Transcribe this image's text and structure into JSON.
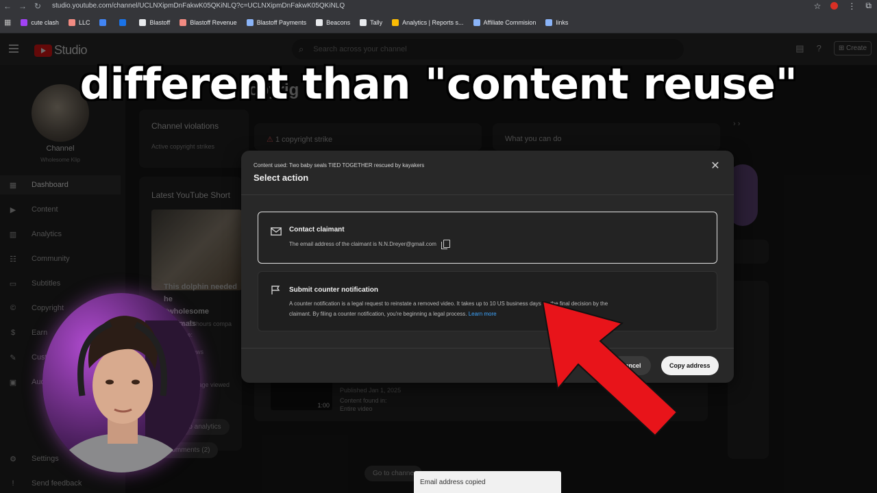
{
  "browser": {
    "url": "studio.youtube.com/channel/UCLNXipmDnFakwK05QKiNLQ?c=UCLNXipmDnFakwK05QKiNLQ",
    "bookmarks": [
      {
        "label": "cute clash",
        "color": "#a142f4"
      },
      {
        "label": "LLC",
        "color": "#f28b82"
      },
      {
        "label": "",
        "color": "#4285f4"
      },
      {
        "label": "",
        "color": "#1a73e8"
      },
      {
        "label": "Blastoff",
        "color": "#e8eaed"
      },
      {
        "label": "Blastoff Revenue",
        "color": "#f28b82"
      },
      {
        "label": "Blastoff Payments",
        "color": "#8ab4f8"
      },
      {
        "label": "Beacons",
        "color": "#e8eaed"
      },
      {
        "label": "Tally",
        "color": "#e8eaed"
      },
      {
        "label": "Analytics | Reports s...",
        "color": "#fbbc04"
      },
      {
        "label": "Affiliate Commision",
        "color": "#8ab4f8"
      },
      {
        "label": "links",
        "color": "#8ab4f8"
      }
    ]
  },
  "studio": {
    "logo_text": "Studio",
    "search_placeholder": "Search across your channel",
    "create_label": "Create"
  },
  "sidebar": {
    "channel_name": "Channel",
    "channel_handle": "Wholesome Klip",
    "items": [
      {
        "label": "Dashboard",
        "icon": "dashboard-icon"
      },
      {
        "label": "Content",
        "icon": "content-icon"
      },
      {
        "label": "Analytics",
        "icon": "analytics-icon"
      },
      {
        "label": "Community",
        "icon": "community-icon"
      },
      {
        "label": "Subtitles",
        "icon": "subtitles-icon"
      },
      {
        "label": "Copyright",
        "icon": "copyright-icon"
      },
      {
        "label": "Earn",
        "icon": "earn-icon"
      },
      {
        "label": "Custo",
        "icon": "customization-icon"
      },
      {
        "label": "Audi",
        "icon": "audio-library-icon"
      }
    ],
    "settings": "Settings",
    "feedback": "Send feedback"
  },
  "dashboard": {
    "channel_violations": "Channel violations",
    "active_strikes": "Active copyright strikes",
    "strike_count": "1 copyright strike",
    "what_you_can_do": "What you can do",
    "latest_shorts": "Latest YouTube Short",
    "short_caption_1": "This dolphin needed he",
    "short_caption_2": "#wholesome #animals",
    "stats_1": "lays 23 hours compa",
    "stats_2": "ice:",
    "stats_3": "ews",
    "stats_4": "entage viewed",
    "btn_video_analytics": "ideo analytics",
    "btn_comments": "e comments (2)",
    "published": "Published Jan 1, 2025",
    "content_found_in": "Content found in:",
    "entire_video": "Entire video",
    "duration": "1:00",
    "go_to_channel": "Go to channe",
    "partial_copyright": "opyrig"
  },
  "dialog": {
    "content_used": "Content used: Two baby seals TIED TOGETHER rescued by kayakers",
    "title": "Select action",
    "option_contact": {
      "title": "Contact claimant",
      "desc": "The email address of the claimant is N.N.Dreyer@gmail.com"
    },
    "option_counter": {
      "title": "Submit counter notification",
      "desc_line1": "A counter notification is a legal request to reinstate a removed video. It takes up to 10 US business days for the final decision by the",
      "desc_line2": "claimant. By filing a counter notification, you're beginning a legal process.",
      "learn_more": "Learn more"
    },
    "cancel": "Cancel",
    "copy_address": "Copy address"
  },
  "toast": "Email address copied",
  "caption": "different than \"content reuse\"",
  "colors": {
    "arrow": "#e8141a",
    "link": "#3ea6ff"
  }
}
